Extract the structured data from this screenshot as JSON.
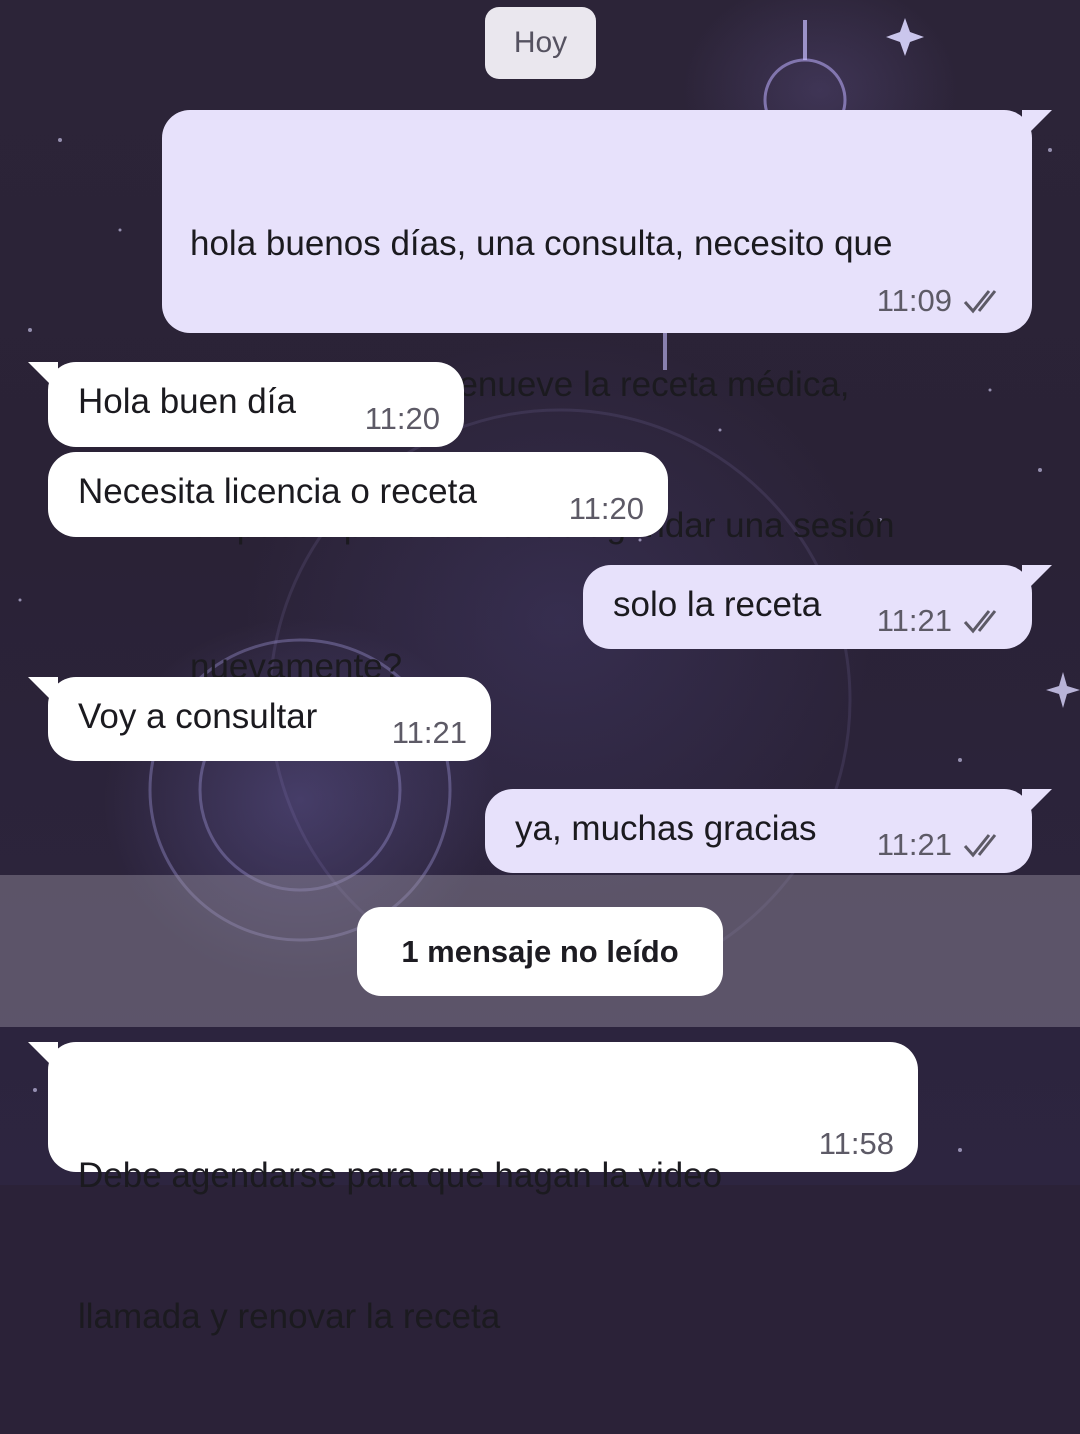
{
  "day_separator": "Hoy",
  "unread_label": "1 mensaje no leído",
  "messages": [
    {
      "direction": "outgoing",
      "lines": [
        "hola buenos días, una consulta, necesito que",
        "el psiquiatra me renueve la receta médica,",
        "se puede por acá o debo agendar una sesión",
        "nuevamente?"
      ],
      "time": "11:09",
      "status": "read"
    },
    {
      "direction": "incoming",
      "lines": [
        "Hola buen día"
      ],
      "time": "11:20"
    },
    {
      "direction": "incoming",
      "lines": [
        "Necesita licencia o receta"
      ],
      "time": "11:20"
    },
    {
      "direction": "outgoing",
      "lines": [
        "solo la receta"
      ],
      "time": "11:21",
      "status": "read"
    },
    {
      "direction": "incoming",
      "lines": [
        "Voy a consultar"
      ],
      "time": "11:21"
    },
    {
      "direction": "outgoing",
      "lines": [
        "ya, muchas gracias"
      ],
      "time": "11:21",
      "status": "read"
    },
    {
      "direction": "incoming",
      "lines": [
        "Debe agendarse para que hagan la video",
        "llamada y renovar la receta"
      ],
      "time": "11:58"
    }
  ],
  "colors": {
    "outgoing_bubble": "#e7e1fb",
    "incoming_bubble": "#ffffff",
    "wallpaper": "#2b2238",
    "meta_text": "#5d5a66"
  }
}
